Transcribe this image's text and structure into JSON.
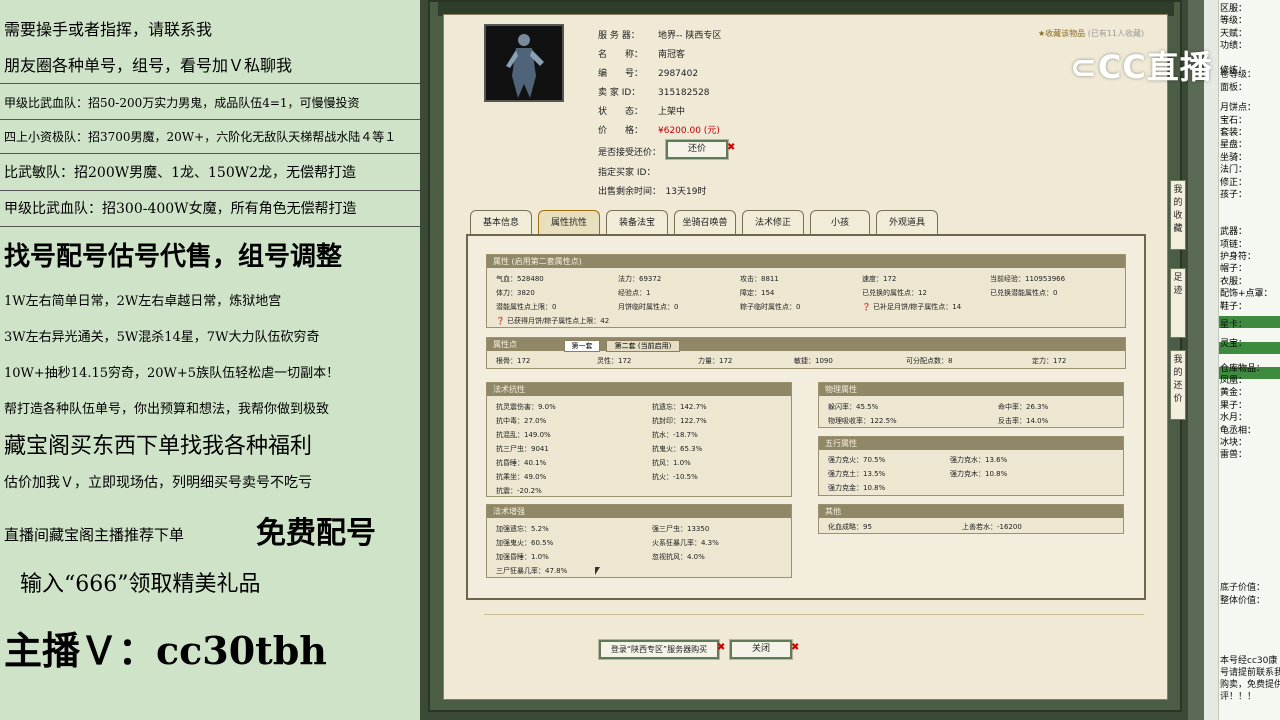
{
  "promo": {
    "l1": "需要操手或者指挥，请联系我",
    "l2": "朋友圈各种单号，组号，看号加Ｖ私聊我",
    "l3": "甲级比武血队：招50-200万实力男鬼，成品队伍4=1，可慢慢投资",
    "l4": "四上小资极队：招3700男魔，20W+，六阶化无敌队天梯帮战水陆４等１",
    "l5": "比武敏队：招200W男魔、1龙、150W2龙，无偿帮打造",
    "l6": "甲级比武血队：招300-400W女魔，所有角色无偿帮打造",
    "l7": "找号配号估号代售，组号调整",
    "l8": "1W左右简单日常，2W左右卓越日常，炼狱地宫",
    "l9": "3W左右异光通关，5W混杀14星，7W大力队伍砍穷奇",
    "l10": "10W+抽秒14.15穷奇，20W+5族队伍轻松虐一切副本！",
    "l11": "帮打造各种队伍单号，你出预算和想法，我帮你做到极致",
    "l12": "藏宝阁买东西下单找我各种福利",
    "l13": "估价加我Ｖ，立即现场估，列明细买号卖号不吃亏",
    "l14a": "直播间藏宝阁主播推荐下单",
    "l14b": "免费配号",
    "l15": "输入“666”领取精美礼品",
    "l16": "主播Ｖ：cc30tbh"
  },
  "listing": {
    "server_label": "服 务 器：",
    "server": "地界-- 陕西专区",
    "name_label": "名　　称：",
    "name": "南冠客",
    "id_label": "编　　号：",
    "id": "2987402",
    "seller_label": "卖 家 ID：",
    "seller_id": "315182528",
    "status_label": "状　　态：",
    "status": "上架中",
    "price_label": "价　　格：",
    "price": "¥6200.00 (元)",
    "counter_label": "是否接受还价：",
    "counter_btn": "还价",
    "buyer_label": "指定买家 ID：",
    "buyer": "",
    "remain_label": "出售剩余时间：",
    "remain": "13天19时",
    "fav": "收藏该物品",
    "fav_count": "(已有11人收藏)"
  },
  "tabs": [
    "基本信息",
    "属性抗性",
    "装备法宝",
    "坐骑召唤兽",
    "法术修正",
    "小孩",
    "外观道具"
  ],
  "attr": {
    "header": "属性 (启用第二套属性点)",
    "rows": [
      [
        "气血：528480",
        "法力：69372",
        "攻击：8811",
        "速度：172",
        "当前经验：110953966"
      ],
      [
        "体力：3820",
        "经验点：1",
        "障定：154",
        "已兑换的属性点：12",
        "已兑换潜能属性点：0"
      ],
      [
        "潜能属性点上限：0",
        "月饼临时属性点：0",
        "粽子临时属性点：0",
        "已补足月饼/粽子属性点：14",
        ""
      ]
    ],
    "note": "已获得月饼/粽子属性点上限：42"
  },
  "points": {
    "header": "属性点",
    "sub1": "第一套",
    "sub2": "第二套 (当前启用)",
    "items": [
      "根骨：172",
      "灵性：172",
      "力量：172",
      "敏捷：1090",
      "可分配点数：8",
      "定力：172"
    ]
  },
  "resist": {
    "header": "法术抗性",
    "left": [
      "抗灵震伤害：9.0%",
      "抗中毒：27.0%",
      "抗混乱：149.0%",
      "抗三尸虫：9041",
      "抗昏睡：40.1%",
      "抗乘坐：49.0%",
      "抗震：-20.2%"
    ],
    "right": [
      "抗遗忘：142.7%",
      "抗封印：122.7%",
      "抗水：-18.7%",
      "抗鬼火：65.3%",
      "抗风：1.0%",
      "抗火：-10.5%"
    ]
  },
  "physical": {
    "header": "物理属性",
    "rows": [
      [
        "躲闪率：45.5%",
        "命中率：26.3%"
      ],
      [
        "物理吸收率：122.5%",
        "反击率：14.0%"
      ]
    ]
  },
  "elements": {
    "header": "五行属性",
    "rows": [
      [
        "强力克火：70.5%",
        "强力克水：13.6%"
      ],
      [
        "强力克土：13.5%",
        "强力克木：10.8%"
      ],
      [
        "强力克金：10.8%",
        ""
      ]
    ]
  },
  "enhance": {
    "header": "法术增强",
    "rows": [
      [
        "加强遗忘：5.2%",
        "强三尸虫：13350"
      ],
      [
        "加强鬼火：60.5%",
        "火系狂暴几率：4.3%"
      ],
      [
        "加强昏睡：1.0%",
        "忽视抗风：4.0%"
      ],
      [
        "三尸狂暴几率：47.8%",
        ""
      ]
    ]
  },
  "other": {
    "header": "其他",
    "rows": [
      [
        "化血成略：95",
        "上善若水：-16200"
      ]
    ]
  },
  "footer": {
    "login_btn": "登录“陕西专区”服务器购买",
    "close_btn": "关闭"
  },
  "side": [
    "我的收藏",
    "足迹",
    "我的还价"
  ],
  "sheet": {
    "rows": [
      "区服：",
      "等级：",
      "天赋：",
      "功绩：",
      "",
      "修炼：",
      "",
      "",
      "月饼点：",
      "宝石：",
      "套装：",
      "星盘：",
      "坐骑：",
      "法门：",
      "修正：",
      "孩子：",
      "",
      "",
      "武器：",
      "项链：",
      "护身符：",
      "帽子：",
      "衣服：",
      "配饰+点罩：",
      "鞋子：",
      "",
      "",
      "灵宝：",
      "",
      "仓库物品：",
      "凤凰：",
      "黄金：",
      "果子：",
      "水月：",
      "龟丞相：",
      "冰块：",
      "雷兽："
    ],
    "special": [
      "卷等级：",
      "面板：",
      "星卡："
    ],
    "bottom": [
      "底子价值：",
      "整体价值："
    ],
    "note": [
      "本号经cc30康",
      "号请提前联系我",
      "购卖，免费提供",
      "评！！！"
    ]
  },
  "logo": "CC直播"
}
